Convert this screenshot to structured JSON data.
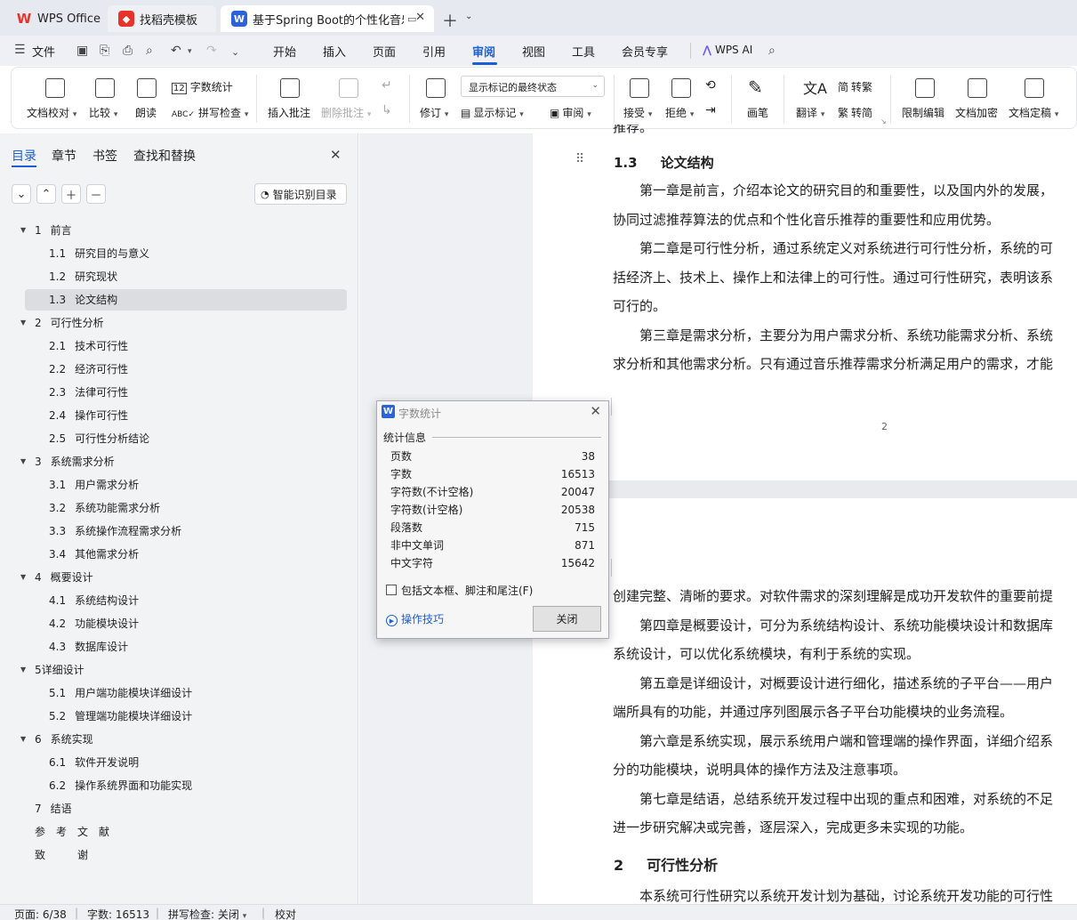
{
  "titlebar": {
    "tabs": [
      {
        "label": "WPS Office",
        "icon": "wps-logo-icon"
      },
      {
        "label": "找稻壳模板",
        "icon": "docer-icon"
      },
      {
        "label": "基于Spring Boot的个性化音乐",
        "icon": "writer-icon",
        "badge": "W"
      }
    ]
  },
  "menu": {
    "file": "文件",
    "tabs": [
      "开始",
      "插入",
      "页面",
      "引用",
      "审阅",
      "视图",
      "工具",
      "会员专享"
    ],
    "active": "审阅",
    "ai": "WPS AI"
  },
  "ribbon": {
    "doc_proof": "文档校对",
    "compare": "比较",
    "read_aloud": "朗读",
    "word_count": "字数统计",
    "spell_check": "拼写检查",
    "insert_comment": "插入批注",
    "delete_comment": "删除批注",
    "revise": "修订",
    "markup_state": "显示标记的最终状态",
    "show_markup": "显示标记",
    "review_pane": "审阅",
    "accept": "接受",
    "reject": "拒绝",
    "pen": "画笔",
    "translate": "翻译",
    "to_traditional": "转繁",
    "to_simplified": "转简",
    "restrict_edit": "限制编辑",
    "encrypt": "文档加密",
    "finalize": "文档定稿"
  },
  "left_pane": {
    "tabs": [
      "目录",
      "章节",
      "书签",
      "查找和替换"
    ],
    "active_tab": "目录",
    "smart_button": "智能识别目录",
    "toc": [
      {
        "num": "1",
        "title": "前言",
        "level": 1
      },
      {
        "num": "1.1",
        "title": "研究目的与意义",
        "level": 2
      },
      {
        "num": "1.2",
        "title": "研究现状",
        "level": 2
      },
      {
        "num": "1.3",
        "title": "论文结构",
        "level": 2
      },
      {
        "num": "2",
        "title": "可行性分析",
        "level": 1
      },
      {
        "num": "2.1",
        "title": "技术可行性",
        "level": 2
      },
      {
        "num": "2.2",
        "title": "经济可行性",
        "level": 2
      },
      {
        "num": "2.3",
        "title": "法律可行性",
        "level": 2
      },
      {
        "num": "2.4",
        "title": "操作可行性",
        "level": 2
      },
      {
        "num": "2.5",
        "title": "可行性分析结论",
        "level": 2
      },
      {
        "num": "3",
        "title": "系统需求分析",
        "level": 1
      },
      {
        "num": "3.1",
        "title": "用户需求分析",
        "level": 2
      },
      {
        "num": "3.2",
        "title": "系统功能需求分析",
        "level": 2
      },
      {
        "num": "3.3",
        "title": "系统操作流程需求分析",
        "level": 2
      },
      {
        "num": "3.4",
        "title": "其他需求分析",
        "level": 2
      },
      {
        "num": "4",
        "title": "概要设计",
        "level": 1
      },
      {
        "num": "4.1",
        "title": "系统结构设计",
        "level": 2
      },
      {
        "num": "4.2",
        "title": "功能模块设计",
        "level": 2
      },
      {
        "num": "4.3",
        "title": "数据库设计",
        "level": 2
      },
      {
        "num": "5详细设计",
        "title": "",
        "level": 1
      },
      {
        "num": "5.1",
        "title": "用户端功能模块详细设计",
        "level": 2
      },
      {
        "num": "5.2",
        "title": "管理端功能模块详细设计",
        "level": 2
      },
      {
        "num": "6",
        "title": "系统实现",
        "level": 1
      },
      {
        "num": "6.1",
        "title": "软件开发说明",
        "level": 2
      },
      {
        "num": "6.2",
        "title": "操作系统界面和功能实现",
        "level": 2
      },
      {
        "num": "7",
        "title": "结语",
        "level": 1
      },
      {
        "num": "参　考　文　献",
        "title": "",
        "level": 1
      },
      {
        "num": "致　　　谢",
        "title": "",
        "level": 1
      }
    ]
  },
  "document": {
    "page1": {
      "top_fragment": "推荐。",
      "heading": {
        "num": "1.3",
        "title": "论文结构"
      },
      "lines": [
        "　　第一章是前言，介绍本论文的研究目的和重要性，以及国内外的发展，",
        "协同过滤推荐算法的优点和个性化音乐推荐的重要性和应用优势。",
        "　　第二章是可行性分析，通过系统定义对系统进行可行性分析，系统的可",
        "括经济上、技术上、操作上和法律上的可行性。通过可行性研究，表明该系",
        "可行的。",
        "　　第三章是需求分析，主要分为用户需求分析、系统功能需求分析、系统",
        "求分析和其他需求分析。只有通过音乐推荐需求分析满足用户的需求，才能"
      ],
      "page_number": "2"
    },
    "page2": {
      "lines": [
        "创建完整、清晰的要求。对软件需求的深刻理解是成功开发软件的重要前提",
        "　　第四章是概要设计，可分为系统结构设计、系统功能模块设计和数据库",
        "系统设计，可以优化系统模块，有利于系统的实现。",
        "　　第五章是详细设计，对概要设计进行细化，描述系统的子平台——用户",
        "端所具有的功能，并通过序列图展示各子平台功能模块的业务流程。",
        "　　第六章是系统实现，展示系统用户端和管理端的操作界面，详细介绍系",
        "分的功能模块，说明具体的操作方法及注意事项。",
        "　　第七章是结语，总结系统开发过程中出现的重点和困难，对系统的不足",
        "进一步研究解决或完善，逐层深入，完成更多未实现的功能。"
      ],
      "heading": {
        "num": "2",
        "title": "可行性分析"
      },
      "last_line": "　　本系统可行性研究以系统开发计划为基础，讨论系统开发功能的可行性"
    }
  },
  "dialog": {
    "title": "字数统计",
    "section": "统计信息",
    "rows": [
      {
        "label": "页数",
        "value": "38"
      },
      {
        "label": "字数",
        "value": "16513"
      },
      {
        "label": "字符数(不计空格)",
        "value": "20047"
      },
      {
        "label": "字符数(计空格)",
        "value": "20538"
      },
      {
        "label": "段落数",
        "value": "715"
      },
      {
        "label": "非中文单词",
        "value": "871"
      },
      {
        "label": "中文字符",
        "value": "15642"
      }
    ],
    "checkbox_label": "包括文本框、脚注和尾注(F)",
    "tips_link": "操作技巧",
    "close_button": "关闭"
  },
  "statusbar": {
    "page": "页面: 6/38",
    "words": "字数: 16513",
    "spell": "拼写检查: 关闭",
    "proof": "校对"
  },
  "colors": {
    "accent": "#1b5fd6",
    "wps_red": "#e8332a"
  }
}
